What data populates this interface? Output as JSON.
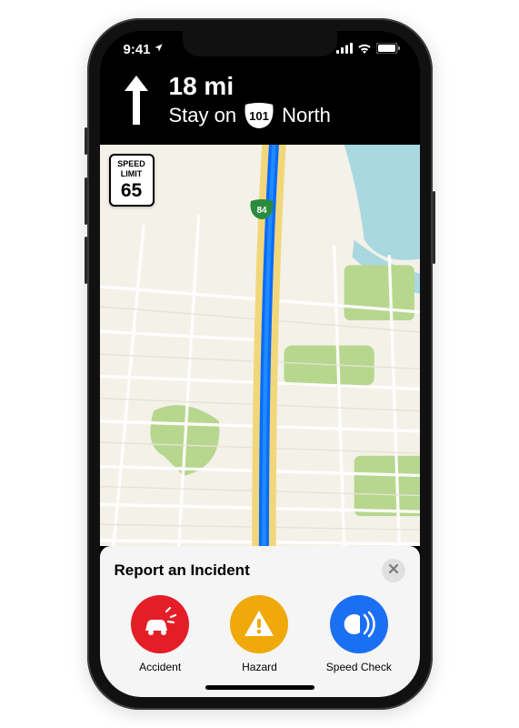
{
  "status_bar": {
    "time": "9:41",
    "location_services": true
  },
  "navigation": {
    "distance": "18 mi",
    "instruction_prefix": "Stay on",
    "route_number": "101",
    "direction": "North"
  },
  "map": {
    "speed_limit": {
      "label1": "SPEED",
      "label2": "LIMIT",
      "value": "65"
    },
    "route_marker": "84"
  },
  "incident_panel": {
    "title": "Report an Incident",
    "options": [
      {
        "id": "accident",
        "label": "Accident",
        "color": "#e41e26",
        "icon": "car-crash-icon"
      },
      {
        "id": "hazard",
        "label": "Hazard",
        "color": "#f0a90b",
        "icon": "warning-triangle-icon"
      },
      {
        "id": "speedcheck",
        "label": "Speed Check",
        "color": "#1b6ff2",
        "icon": "speed-radar-icon"
      }
    ]
  }
}
